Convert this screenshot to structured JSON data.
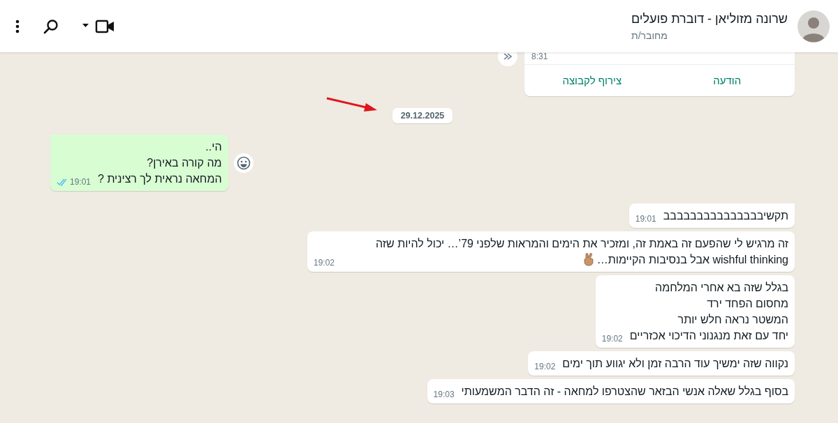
{
  "header": {
    "name": "שרונה מזוליאן - דוברת פועלים",
    "status": "מחובר/ת"
  },
  "card": {
    "time": "8:31",
    "actions": [
      "הודעה",
      "צירוף לקבוצה"
    ]
  },
  "date_chip": "29.12.2025",
  "messages": [
    {
      "kind": "outgoing",
      "lines": [
        "הי..",
        "מה קורה באירן?",
        "המחאה נראית לך רצינית ?"
      ],
      "time": "19:01",
      "read": true,
      "emoji": false
    },
    {
      "kind": "incoming",
      "lines": [
        "תקשיבבבבבבבבבבבבבבב"
      ],
      "time": "19:01",
      "emoji": false
    },
    {
      "kind": "incoming",
      "lines": [
        "זה מרגיש לי שהפעם זה באמת זה, ומזכיר את הימים והמראות שלפני 79’… יכול להיות שזה wishful thinking אבל בנסיבות הקיימות…"
      ],
      "time": "19:02",
      "emoji": true
    },
    {
      "kind": "incoming",
      "lines": [
        "בגלל שזה בא אחרי המלחמה",
        "מחסום הפחד ירד",
        "המשטר נראה חלש יותר",
        "יחד עם זאת מנגנוני הדיכוי אכזריים"
      ],
      "time": "19:02",
      "emoji": false
    },
    {
      "kind": "incoming",
      "lines": [
        "נקווה שזה ימשיך עוד הרבה זמן ולא יגווע תוך ימים"
      ],
      "time": "19:02",
      "emoji": false
    },
    {
      "kind": "incoming",
      "lines": [
        "בסוף בגלל שאלה אנשי הבזאר שהצטרפו למחאה - זה הדבר המשמעותי"
      ],
      "time": "19:03",
      "emoji": false
    }
  ]
}
